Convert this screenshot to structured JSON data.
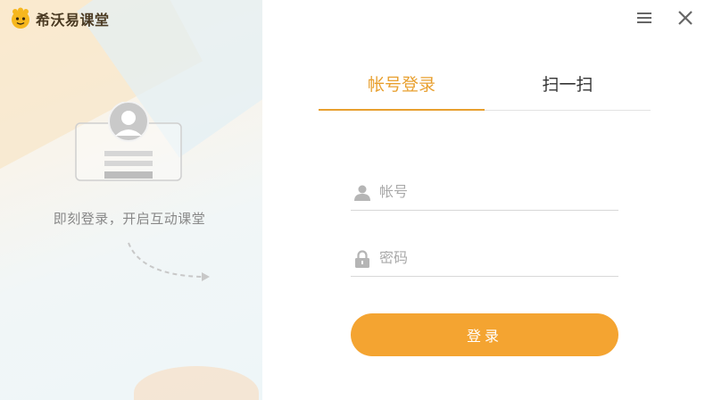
{
  "app": {
    "name": "希沃易课堂"
  },
  "illustration": {
    "caption": "即刻登录，开启互动课堂"
  },
  "tabs": [
    {
      "label": "帐号登录",
      "active": true
    },
    {
      "label": "扫一扫",
      "active": false
    }
  ],
  "form": {
    "account": {
      "placeholder": "帐号",
      "value": ""
    },
    "password": {
      "placeholder": "密码",
      "value": ""
    },
    "submit_label": "登录"
  },
  "icons": {
    "menu": "menu-icon",
    "close": "close-icon",
    "user": "user-icon",
    "lock": "lock-icon"
  },
  "colors": {
    "accent": "#f4a431",
    "tab_active": "#e8a030",
    "text": "#333333",
    "muted": "#aaaaaa"
  }
}
